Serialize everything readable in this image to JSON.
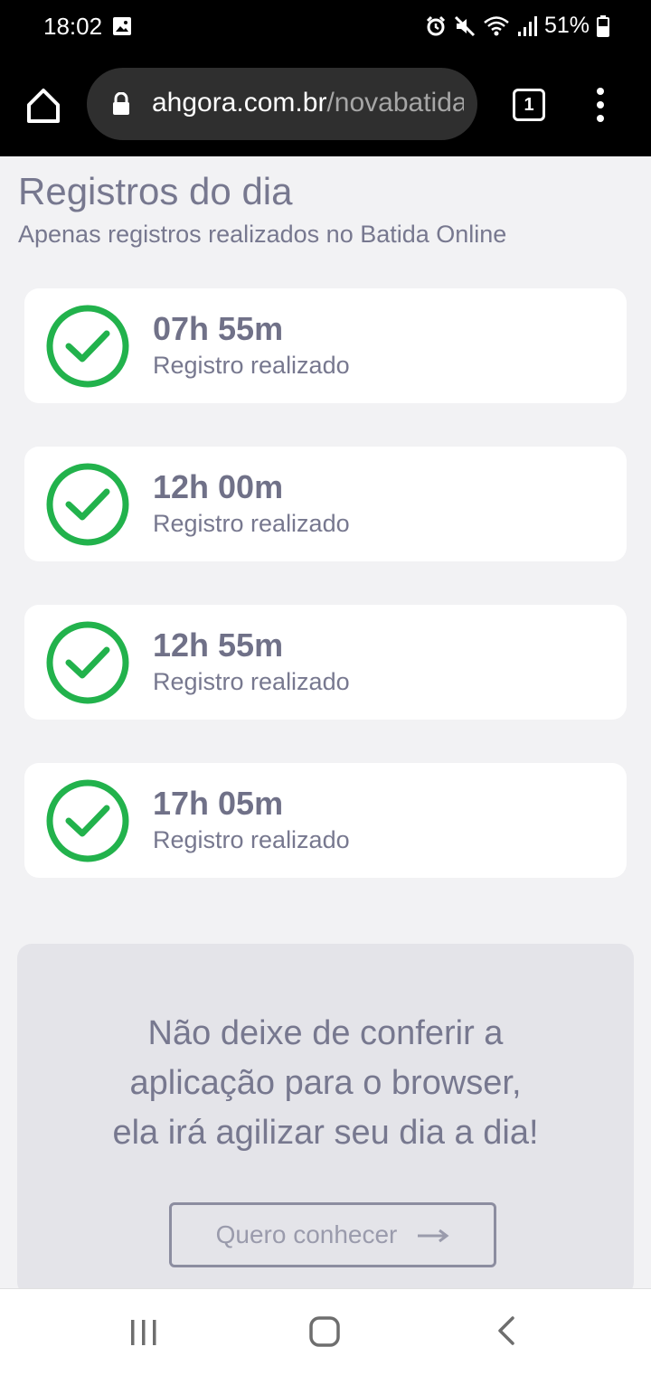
{
  "status_bar": {
    "time": "18:02",
    "battery": "51%",
    "icons": [
      "image-icon",
      "alarm-icon",
      "mute-icon",
      "wifi-icon",
      "signal-icon",
      "battery-icon"
    ]
  },
  "browser": {
    "url_domain": "ahgora.com.br",
    "url_path": "/novabatida",
    "tab_count": "1",
    "icons": [
      "home-icon",
      "lock-icon",
      "more-vert-icon"
    ]
  },
  "page": {
    "title": "Registros do dia",
    "subtitle": "Apenas registros realizados no Batida Online"
  },
  "records": [
    {
      "time": "07h 55m",
      "status": "Registro realizado"
    },
    {
      "time": "12h 00m",
      "status": "Registro realizado"
    },
    {
      "time": "12h 55m",
      "status": "Registro realizado"
    },
    {
      "time": "17h 05m",
      "status": "Registro realizado"
    }
  ],
  "promo": {
    "line1": "Não deixe de conferir a",
    "line2": "aplicação para o browser,",
    "line3": "ela irá agilizar seu dia a dia!",
    "button_label": "Quero conhecer",
    "button_icon": "arrow-right-icon"
  },
  "nav": {
    "icons": [
      "recent-apps-icon",
      "home-nav-icon",
      "back-icon"
    ]
  },
  "colors": {
    "accent_green": "#22b24c",
    "text_gray": "#77788f",
    "background": "#f2f2f4"
  }
}
